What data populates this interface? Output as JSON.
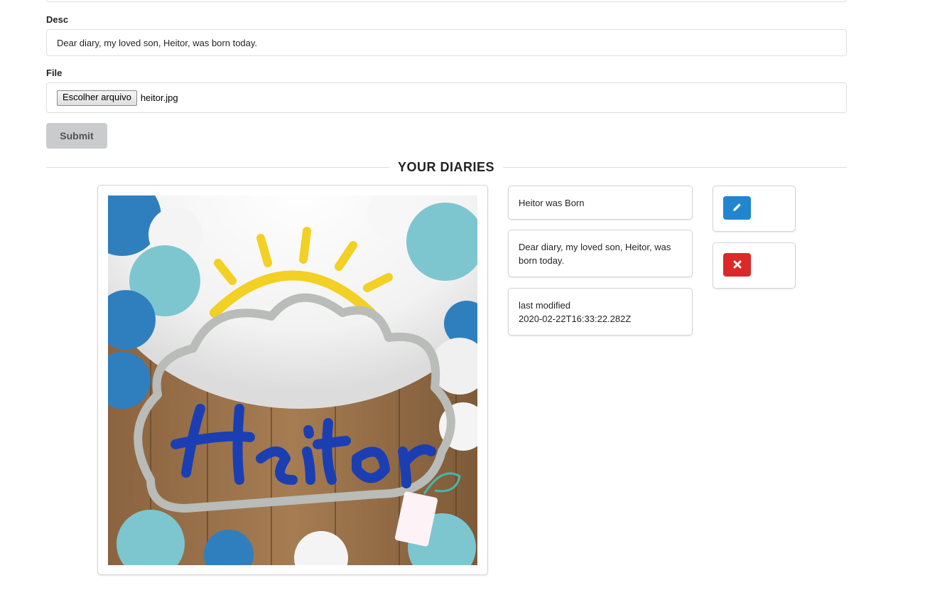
{
  "form": {
    "desc_label": "Desc",
    "desc_value": "Dear diary, my loved son, Heitor, was born today.",
    "file_label": "File",
    "file_button_label": "Escolher arquivo",
    "file_name": "heitor.jpg",
    "submit_label": "Submit"
  },
  "section_title": "YOUR DIARIES",
  "diary": {
    "title": "Heitor was Born",
    "description": "Dear diary, my loved son, Heitor, was born today.",
    "modified_label": "last modified",
    "modified_value": "2020-02-22T16:33:22.282Z",
    "photo_icon": "photo-heitor-knitted-name-cloud-sun",
    "edit_icon": "pencil-icon",
    "delete_icon": "close-icon"
  },
  "colors": {
    "edit_button": "#2185d0",
    "delete_button": "#db2828",
    "submit_button": "#cacbcd"
  }
}
